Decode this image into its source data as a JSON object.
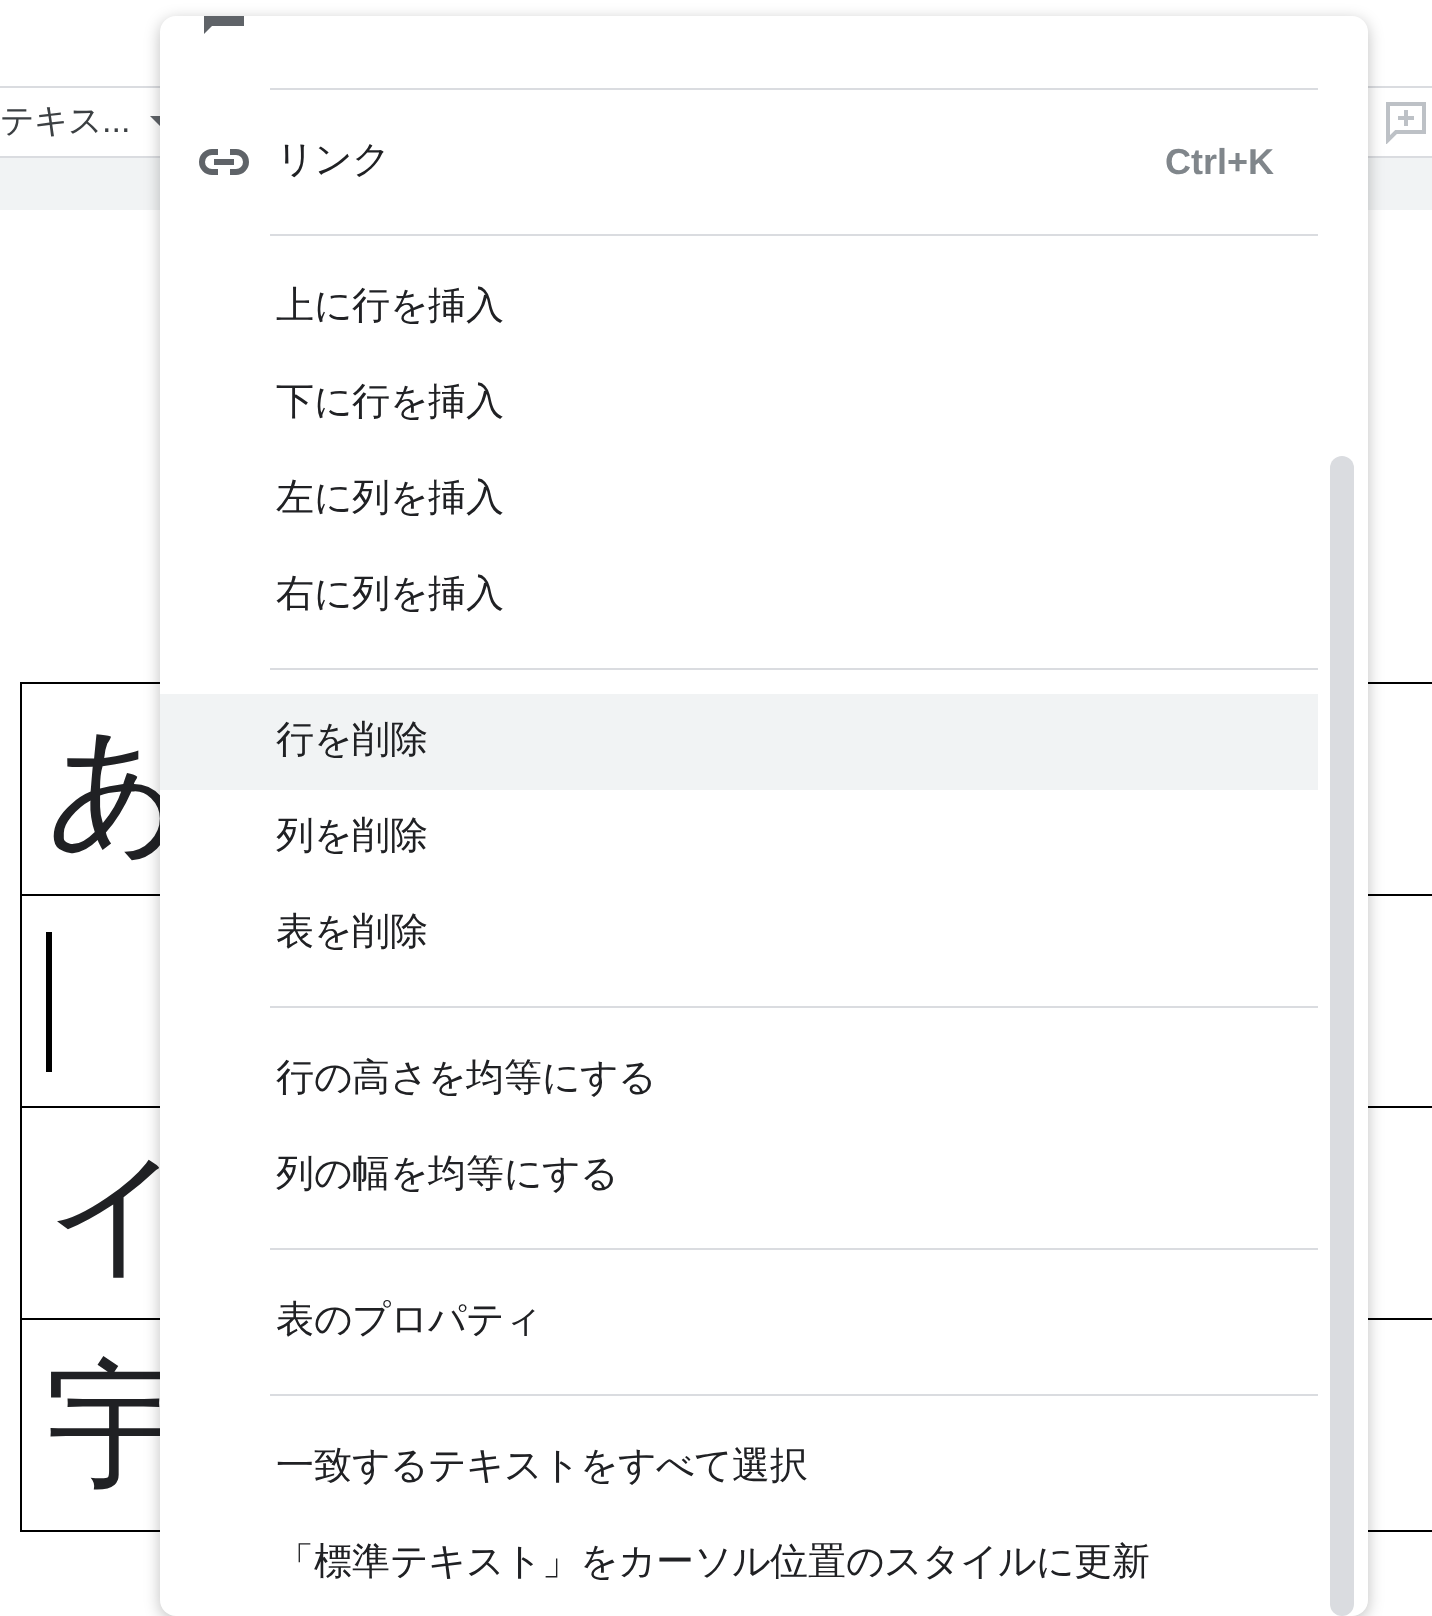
{
  "toolbar": {
    "style_select": "テキス..."
  },
  "table": {
    "rows": [
      {
        "text": "あ",
        "cursor": false
      },
      {
        "text": "",
        "cursor": true
      },
      {
        "text": "イ",
        "cursor": false
      },
      {
        "text": "宇",
        "cursor": false
      }
    ]
  },
  "context_menu": {
    "groups": [
      [
        {
          "kind": "comment",
          "highlighted": false
        }
      ],
      [
        {
          "label": "リンク",
          "kind": "link",
          "shortcut": "Ctrl+K",
          "highlighted": false
        }
      ],
      [
        {
          "label": "上に行を挿入",
          "highlighted": false
        },
        {
          "label": "下に行を挿入",
          "highlighted": false
        },
        {
          "label": "左に列を挿入",
          "highlighted": false
        },
        {
          "label": "右に列を挿入",
          "highlighted": false
        }
      ],
      [
        {
          "label": "行を削除",
          "highlighted": true
        },
        {
          "label": "列を削除",
          "highlighted": false
        },
        {
          "label": "表を削除",
          "highlighted": false
        }
      ],
      [
        {
          "label": "行の高さを均等にする",
          "highlighted": false
        },
        {
          "label": "列の幅を均等にする",
          "highlighted": false
        }
      ],
      [
        {
          "label": "表のプロパティ",
          "highlighted": false
        }
      ],
      [
        {
          "label": "一致するテキストをすべて選択",
          "highlighted": false
        },
        {
          "label": "「標準テキスト」をカーソル位置のスタイルに更新",
          "highlighted": false
        }
      ]
    ]
  }
}
